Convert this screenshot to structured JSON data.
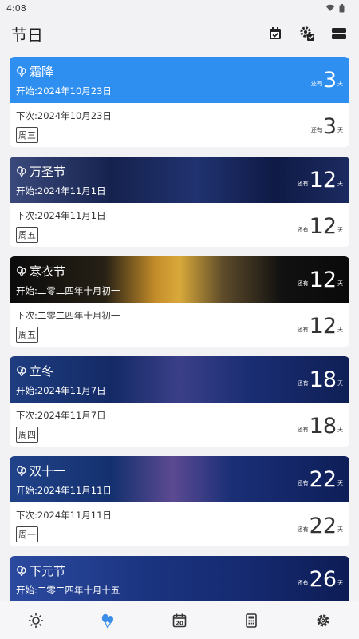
{
  "status": {
    "time": "4:08"
  },
  "header": {
    "title": "节日"
  },
  "events": [
    {
      "name": "霜降",
      "start": "开始:2024年10月23日",
      "next": "下次:2024年10月23日",
      "weekday": "周三",
      "pre": "还有",
      "days": "3",
      "suffix": "天"
    },
    {
      "name": "万圣节",
      "start": "开始:2024年11月1日",
      "next": "下次:2024年11月1日",
      "weekday": "周五",
      "pre": "还有",
      "days": "12",
      "suffix": "天"
    },
    {
      "name": "寒衣节",
      "start": "开始:二零二四年十月初一",
      "next": "下次:二零二四年十月初一",
      "weekday": "周五",
      "pre": "还有",
      "days": "12",
      "suffix": "天"
    },
    {
      "name": "立冬",
      "start": "开始:2024年11月7日",
      "next": "下次:2024年11月7日",
      "weekday": "周四",
      "pre": "还有",
      "days": "18",
      "suffix": "天"
    },
    {
      "name": "双十一",
      "start": "开始:2024年11月11日",
      "next": "下次:2024年11月11日",
      "weekday": "周一",
      "pre": "还有",
      "days": "22",
      "suffix": "天"
    },
    {
      "name": "下元节",
      "start": "开始:二零二四年十月十五",
      "next": "",
      "weekday": "",
      "pre": "还有",
      "days": "26",
      "suffix": "天"
    }
  ],
  "nav": {
    "calendar_date": "20",
    "active": "festivals",
    "accent": "#2f8ff0"
  }
}
